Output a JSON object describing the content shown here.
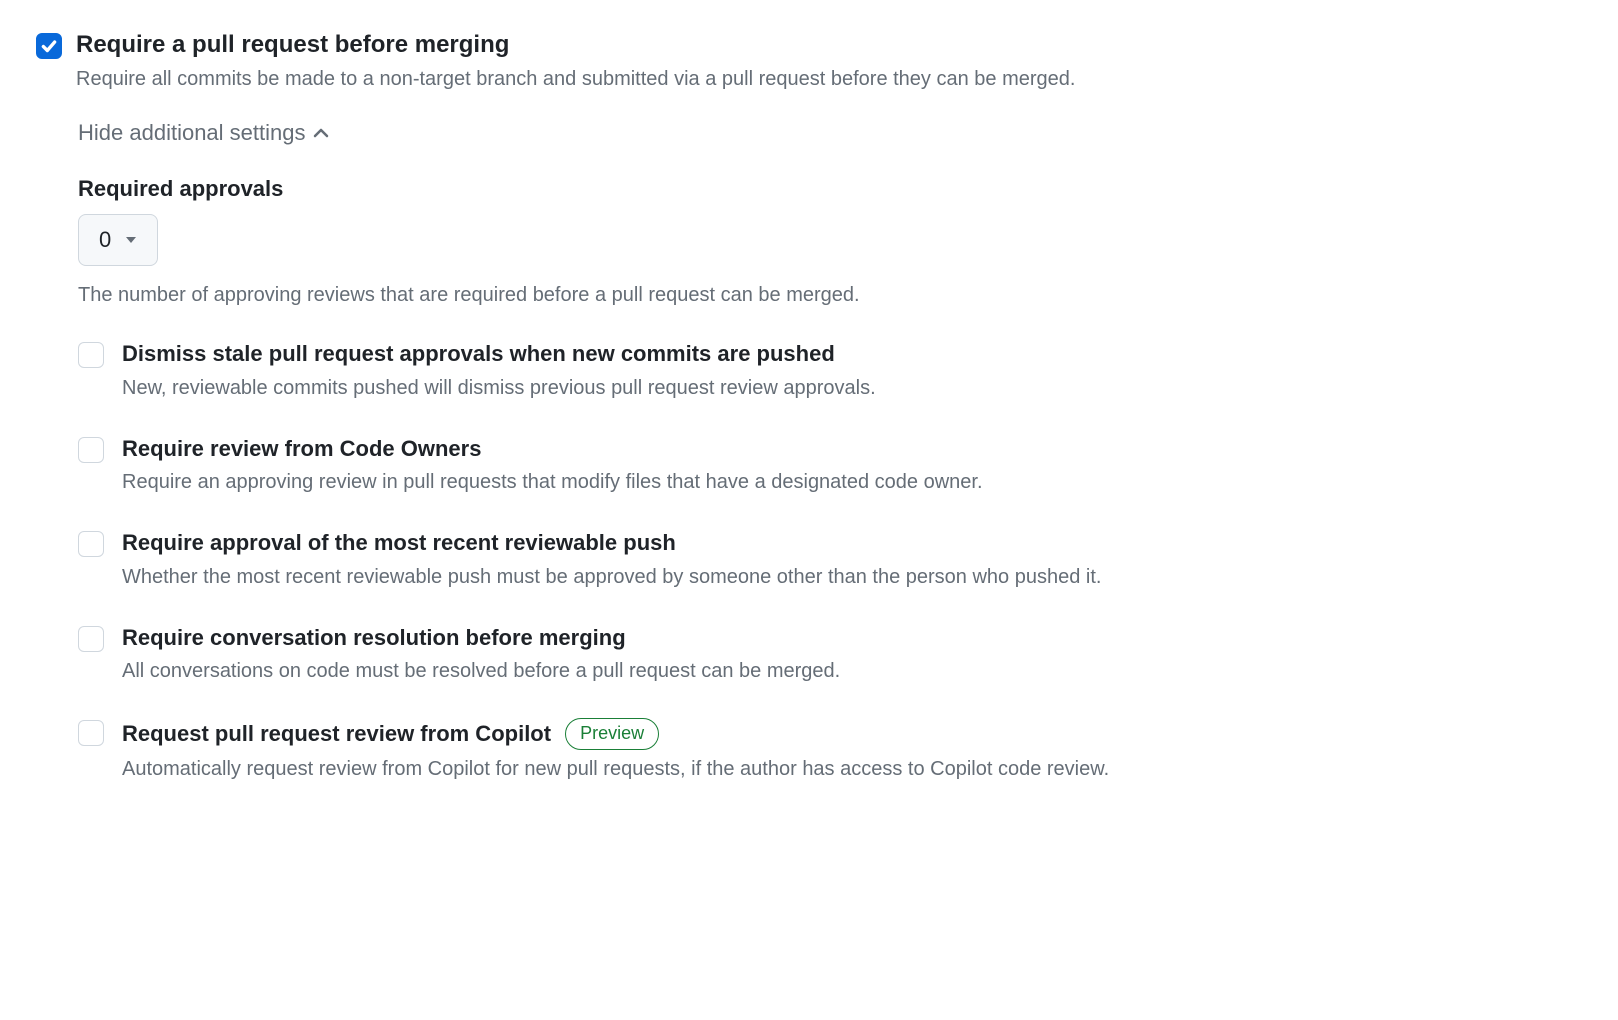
{
  "mainRule": {
    "title": "Require a pull request before merging",
    "description": "Require all commits be made to a non-target branch and submitted via a pull request before they can be merged.",
    "checked": true
  },
  "toggle": {
    "label": "Hide additional settings"
  },
  "requiredApprovals": {
    "label": "Required approvals",
    "value": "0",
    "helper": "The number of approving reviews that are required before a pull request can be merged."
  },
  "subRules": [
    {
      "title": "Dismiss stale pull request approvals when new commits are pushed",
      "description": "New, reviewable commits pushed will dismiss previous pull request review approvals.",
      "checked": false
    },
    {
      "title": "Require review from Code Owners",
      "description": "Require an approving review in pull requests that modify files that have a designated code owner.",
      "checked": false
    },
    {
      "title": "Require approval of the most recent reviewable push",
      "description": "Whether the most recent reviewable push must be approved by someone other than the person who pushed it.",
      "checked": false
    },
    {
      "title": "Require conversation resolution before merging",
      "description": "All conversations on code must be resolved before a pull request can be merged.",
      "checked": false
    },
    {
      "title": "Request pull request review from Copilot",
      "description": "Automatically request review from Copilot for new pull requests, if the author has access to Copilot code review.",
      "checked": false,
      "badge": "Preview"
    }
  ]
}
